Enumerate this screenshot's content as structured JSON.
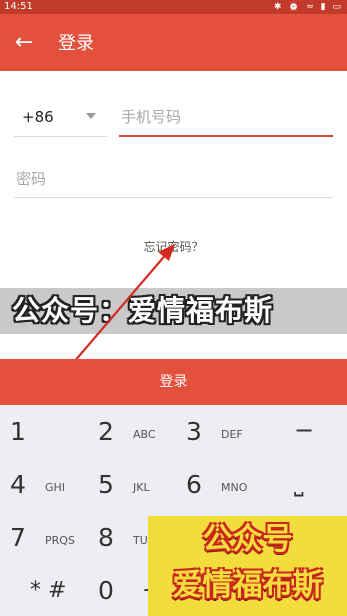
{
  "status_bar": {
    "time": "14:51",
    "icons": "✱ ⏰ ≈ ▮ ▭"
  },
  "app_bar": {
    "back_icon": "arrow-left-icon",
    "back_glyph": "←",
    "title": "登录"
  },
  "form": {
    "country_code": "+86",
    "phone_placeholder": "手机号码",
    "password_placeholder": "密码",
    "forgot_password": "忘记密码？"
  },
  "watermark": {
    "text": "公众号：爱情福布斯"
  },
  "login_button": "登录",
  "keypad": {
    "row1": [
      {
        "num": "1",
        "letters": ""
      },
      {
        "num": "2",
        "letters": "ABC"
      },
      {
        "num": "3",
        "letters": "DEF"
      },
      {
        "sym": "−"
      }
    ],
    "row2": [
      {
        "num": "4",
        "letters": "GHI"
      },
      {
        "num": "5",
        "letters": "JKL"
      },
      {
        "num": "6",
        "letters": "MNO"
      },
      {
        "sym": "⎵"
      }
    ],
    "row3": [
      {
        "num": "7",
        "letters": "PRQS"
      },
      {
        "num": "8",
        "letters": "TU"
      }
    ],
    "row4": [
      {
        "sym": "* #"
      },
      {
        "num": "0",
        "letters": ""
      },
      {
        "sym": "+"
      }
    ]
  },
  "promo": {
    "line1": "公众号",
    "line2": "爱情福布斯"
  },
  "colors": {
    "brand_red": "#e3503c",
    "status_red": "#c23b2a",
    "keypad_bg": "#eceef2",
    "annotation_red": "#d42a1f"
  }
}
